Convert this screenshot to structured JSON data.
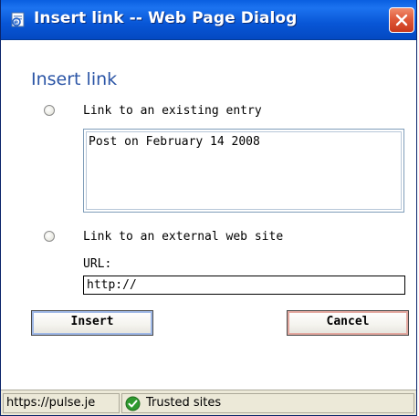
{
  "window": {
    "title": "Insert link -- Web Page Dialog",
    "icons": {
      "title": "ie-page-icon",
      "close": "close-icon"
    },
    "colors": {
      "titlebar": "#0856d6",
      "close": "#e05a3a",
      "heading": "#2b55a6"
    }
  },
  "dialog": {
    "heading": "Insert link",
    "option_existing_label": "Link to an existing entry",
    "entries": [
      "Post on February 14 2008"
    ],
    "option_external_label": "Link to an external web site",
    "url_label": "URL:",
    "url_value": "http://",
    "insert_label": "Insert",
    "cancel_label": "Cancel"
  },
  "statusbar": {
    "url_text": "https://pulse.je",
    "zone_text": "Trusted sites",
    "zone_icon": "trusted-sites-check-icon"
  }
}
